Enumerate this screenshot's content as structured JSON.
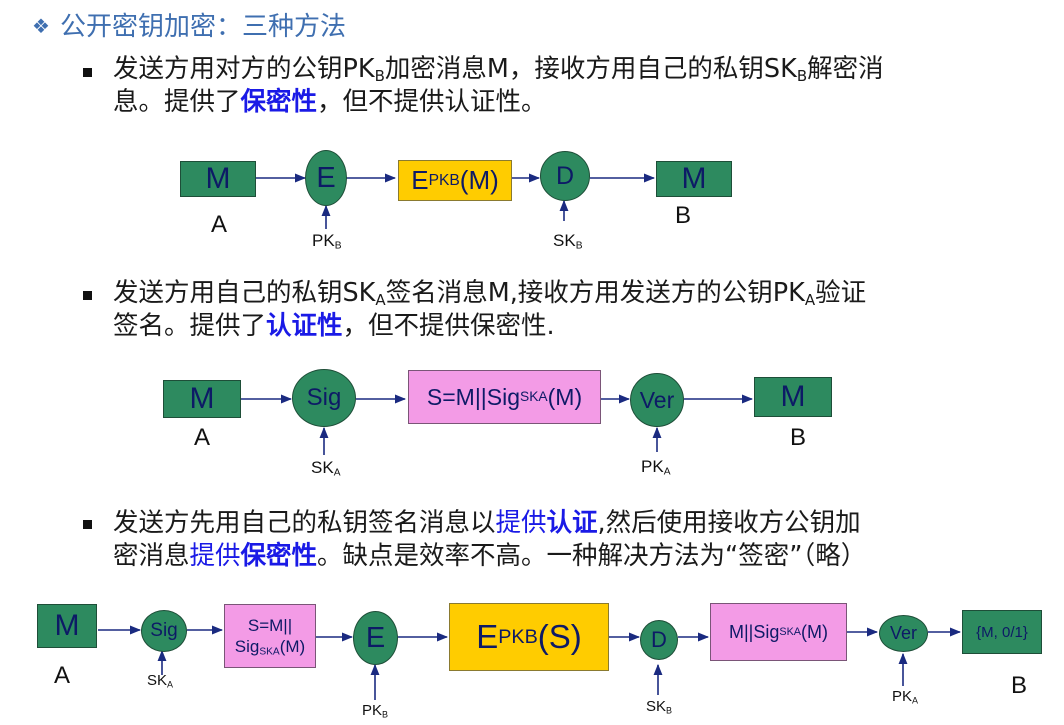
{
  "title": "公开密钥加密：三种方法",
  "methods": [
    {
      "line1_a": "发送方用对方的公钥PK",
      "line1_b": "加密消息M，接收方用自己的私钥SK",
      "line1_c": "解密消",
      "line2_a": "息。提供了",
      "line2_emph": "保密性",
      "line2_b": "，但不提供认证性。"
    },
    {
      "line1_a": "发送方用自己的私钥SK",
      "line1_b": "签名消息M,接收方用发送方的公钥PK",
      "line1_c": "验证",
      "line2_a": "签名。提供了",
      "line2_emph": "认证性",
      "line2_b": "，但不提供保密性."
    },
    {
      "line1_a": "发送方先用自己的私钥签名消息以",
      "line1_blue": "提供",
      "line1_emph": "认证",
      "line1_b": ",然后使用接收方公钥加",
      "line2_a": "密消息",
      "line2_blue": "提供",
      "line2_emph": "保密性",
      "line2_b": "。缺点是效率不高。一种解决方法为“签密”（略）"
    }
  ],
  "diagram1": {
    "M1": "M",
    "E": "E",
    "enc_a": "E",
    "enc_b": "(M)",
    "D": "D",
    "M2": "M",
    "A": "A",
    "B": "B",
    "PK": "PK",
    "SK": "SK"
  },
  "diagram2": {
    "M1": "M",
    "Sig": "Sig",
    "sig_a": "S=M||Sig",
    "sig_b": "(M)",
    "Ver": "Ver",
    "M2": "M",
    "A": "A",
    "B": "B",
    "SK": "SK",
    "PK": "PK"
  },
  "diagram3": {
    "M1": "M",
    "Sig": "Sig",
    "s_line1": "S=M||",
    "s_line2a": "Sig",
    "s_line2b": "(M)",
    "E": "E",
    "enc_a": "E",
    "enc_b": "(S)",
    "D": "D",
    "msig_a": "M||Sig",
    "msig_b": "(M)",
    "Ver": "Ver",
    "result": "{M, 0/1}",
    "A": "A",
    "B": "B",
    "SK_sig": "SK",
    "PK_enc": "PK",
    "SK_dec": "SK",
    "PK_ver": "PK"
  }
}
